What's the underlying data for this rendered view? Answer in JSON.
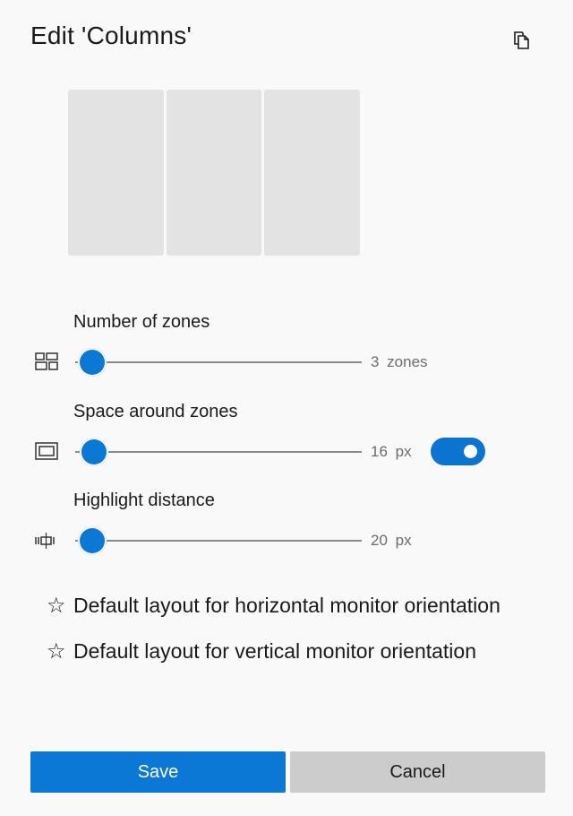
{
  "dialog": {
    "title": "Edit 'Columns'"
  },
  "toolbar": {
    "copy_icon": "duplicate-icon"
  },
  "preview": {
    "zone_count": 3
  },
  "settings": {
    "zones": {
      "label": "Number of zones",
      "icon": "zones-grid-icon",
      "value": "3",
      "unit": "zones",
      "value_text": "3  zones",
      "slider_fraction": 0.06
    },
    "space": {
      "label": "Space around zones",
      "icon": "space-frame-icon",
      "value": "16",
      "unit": "px",
      "value_text": "16  px",
      "slider_fraction": 0.065,
      "toggle_on": true
    },
    "highlight": {
      "label": "Highlight distance",
      "icon": "highlight-distance-icon",
      "value": "20",
      "unit": "px",
      "value_text": "20  px",
      "slider_fraction": 0.06
    }
  },
  "defaults": {
    "horizontal": "Default layout for horizontal monitor orientation",
    "vertical": "Default layout for vertical monitor orientation",
    "star_icon": "star-outline-icon"
  },
  "buttons": {
    "save": "Save",
    "cancel": "Cancel"
  },
  "colors": {
    "accent": "#0a78d4",
    "zone_fill": "#e3e3e3",
    "cancel_bg": "#cccccc",
    "background": "#f9f9f9"
  }
}
